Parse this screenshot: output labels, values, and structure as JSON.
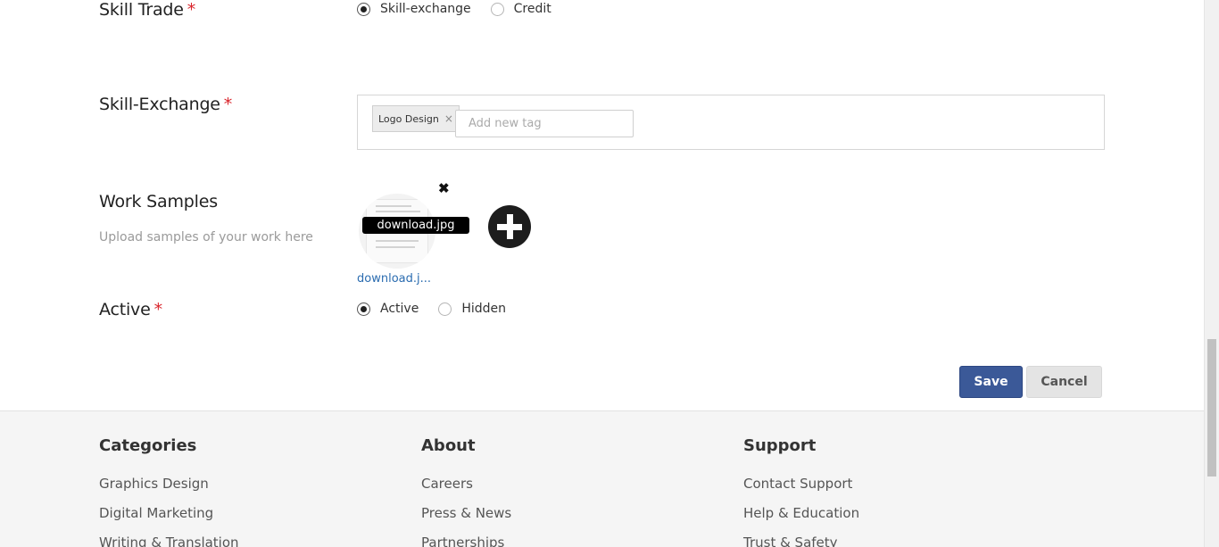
{
  "skill_trade": {
    "label": "Skill Trade",
    "required_mark": "*",
    "options": [
      "Skill-exchange",
      "Credit"
    ],
    "selected": "Skill-exchange"
  },
  "skill_exchange": {
    "label": "Skill-Exchange",
    "required_mark": "*",
    "tags": [
      "Logo Design"
    ],
    "tag_remove": "×",
    "input_placeholder": "Add new tag"
  },
  "work_samples": {
    "label": "Work Samples",
    "hint": "Upload samples of your work here",
    "file_caption": "download.jpg",
    "file_link": "download.j...",
    "remove_glyph": "✖"
  },
  "active": {
    "label": "Active",
    "required_mark": "*",
    "options": [
      "Active",
      "Hidden"
    ],
    "selected": "Active"
  },
  "actions": {
    "save": "Save",
    "cancel": "Cancel"
  },
  "footer": {
    "columns": [
      {
        "heading": "Categories",
        "links": [
          "Graphics Design",
          "Digital Marketing",
          "Writing & Translation"
        ]
      },
      {
        "heading": "About",
        "links": [
          "Careers",
          "Press & News",
          "Partnerships"
        ]
      },
      {
        "heading": "Support",
        "links": [
          "Contact Support",
          "Help & Education",
          "Trust & Safety"
        ]
      }
    ]
  },
  "colors": {
    "primary": "#3b5998",
    "required": "#d9242b",
    "link": "#2b6cb0"
  }
}
